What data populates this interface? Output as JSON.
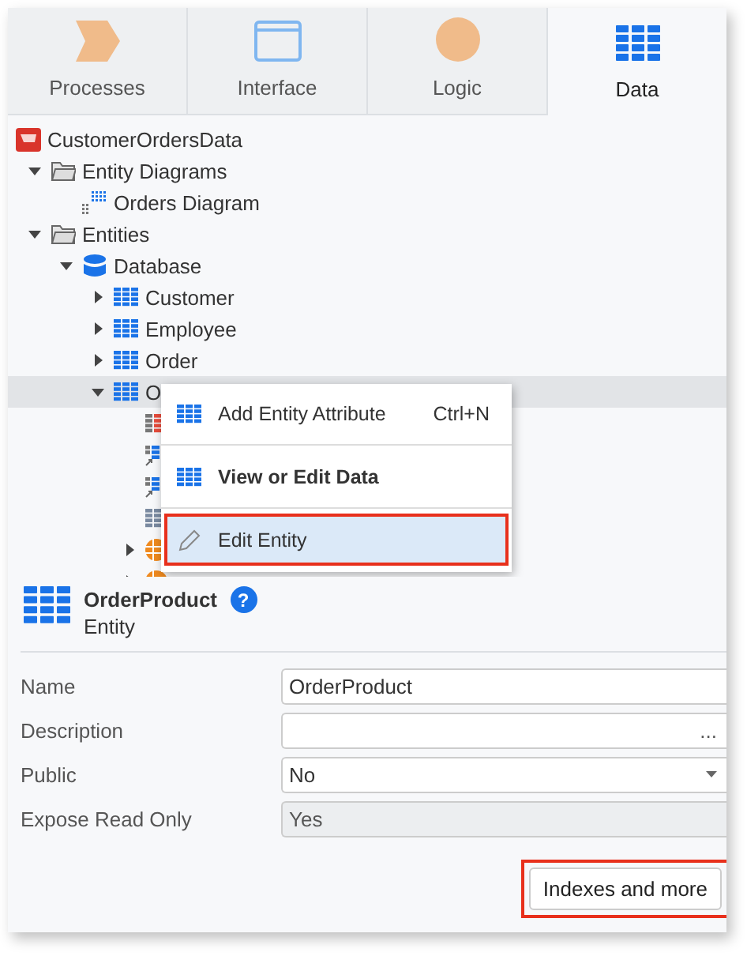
{
  "tabs": [
    {
      "label": "Processes",
      "kind": "processes",
      "selected": false
    },
    {
      "label": "Interface",
      "kind": "interface",
      "selected": false
    },
    {
      "label": "Logic",
      "kind": "logic",
      "selected": false
    },
    {
      "label": "Data",
      "kind": "data",
      "selected": true
    }
  ],
  "tree": {
    "label": "CustomerOrdersData",
    "kind": "module",
    "selected": false,
    "children": [
      {
        "label": "Entity Diagrams",
        "kind": "folder",
        "expanded": true,
        "selected": false,
        "children": [
          {
            "label": "Orders Diagram",
            "kind": "diagram",
            "selected": false
          }
        ]
      },
      {
        "label": "Entities",
        "kind": "folder",
        "expanded": true,
        "selected": false,
        "children": [
          {
            "label": "Database",
            "kind": "database",
            "expanded": true,
            "selected": false,
            "children": [
              {
                "label": "Customer",
                "kind": "entity",
                "expanded": false,
                "selected": false
              },
              {
                "label": "Employee",
                "kind": "entity",
                "expanded": false,
                "selected": false
              },
              {
                "label": "Order",
                "kind": "entity",
                "expanded": false,
                "selected": false
              },
              {
                "label": "O",
                "kind": "entity",
                "expanded": true,
                "selected": true,
                "children": [
                  {
                    "kind": "identifier"
                  },
                  {
                    "kind": "reference"
                  },
                  {
                    "kind": "reference"
                  },
                  {
                    "kind": "attribute"
                  },
                  {
                    "kind": "structure",
                    "expanded": false
                  },
                  {
                    "kind": "structure",
                    "expanded": false
                  }
                ]
              }
            ]
          }
        ]
      }
    ]
  },
  "context_menu": [
    {
      "label": "Add Entity Attribute",
      "shortcut": "Ctrl+N",
      "kind": "entity",
      "bold": false,
      "selected": false,
      "outlined": false
    },
    {
      "label": "View or Edit Data",
      "kind": "entity",
      "bold": true,
      "selected": false,
      "outlined": false
    },
    {
      "label": "Edit Entity",
      "kind": "edit",
      "bold": false,
      "selected": true,
      "outlined": true
    }
  ],
  "properties": {
    "title": "OrderProduct",
    "subtitle": "Entity",
    "help": "?",
    "rows": [
      {
        "label": "Name",
        "kind": "text",
        "value": "OrderProduct"
      },
      {
        "label": "Description",
        "kind": "ellipsis",
        "button": "..."
      },
      {
        "label": "Public",
        "kind": "select",
        "value": "No"
      },
      {
        "label": "Expose Read Only",
        "kind": "readonly",
        "value": "Yes"
      }
    ],
    "button": {
      "label": "Indexes and more",
      "outlined": true
    }
  }
}
